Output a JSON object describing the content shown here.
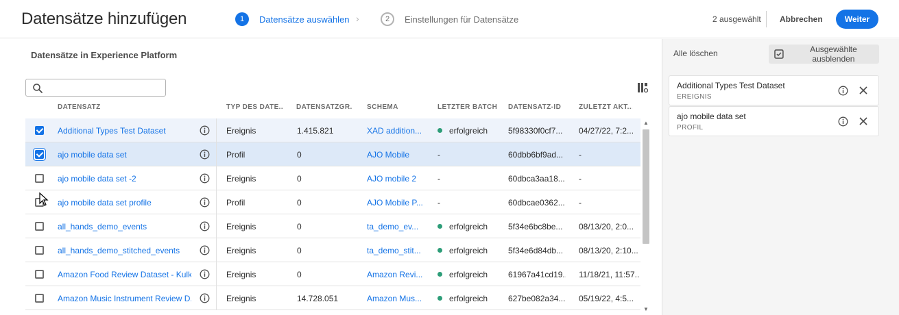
{
  "header": {
    "title": "Datensätze hinzufügen",
    "steps": [
      {
        "num": "1",
        "label": "Datensätze auswählen",
        "active": true
      },
      {
        "num": "2",
        "label": "Einstellungen für Datensätze",
        "active": false
      }
    ],
    "selected_count": "2 ausgewählt",
    "cancel_label": "Abbrechen",
    "next_label": "Weiter"
  },
  "main": {
    "section_title": "Datensätze in Experience Platform",
    "search": {
      "value": "",
      "placeholder": ""
    },
    "columns": [
      "DATENSATZ",
      "TYP DES DATE...",
      "DATENSATZGR...",
      "SCHEMA",
      "LETZTER BATCH",
      "DATENSATZ-ID",
      "ZULETZT AKT..."
    ],
    "rows": [
      {
        "checked": true,
        "name": "Additional Types Test Dataset",
        "type": "Ereignis",
        "size": "1.415.821",
        "schema": "XAD addition...",
        "batch": "erfolgreich",
        "batch_ok": true,
        "id": "5f98330f0cf7...",
        "updated": "04/27/22, 7:2..."
      },
      {
        "checked": true,
        "name": "ajo mobile data set",
        "type": "Profil",
        "size": "0",
        "schema": "AJO Mobile",
        "batch": "-",
        "batch_ok": false,
        "id": "60dbb6bf9ad...",
        "updated": "-"
      },
      {
        "checked": false,
        "name": "ajo mobile data set -2",
        "type": "Ereignis",
        "size": "0",
        "schema": "AJO mobile 2",
        "batch": "-",
        "batch_ok": false,
        "id": "60dbca3aa18...",
        "updated": "-"
      },
      {
        "checked": false,
        "name": "ajo mobile data set profile",
        "type": "Profil",
        "size": "0",
        "schema": "AJO Mobile P...",
        "batch": "-",
        "batch_ok": false,
        "id": "60dbcae0362...",
        "updated": "-"
      },
      {
        "checked": false,
        "name": "all_hands_demo_events",
        "type": "Ereignis",
        "size": "0",
        "schema": "ta_demo_ev...",
        "batch": "erfolgreich",
        "batch_ok": true,
        "id": "5f34e6bc8be...",
        "updated": "08/13/20, 2:0..."
      },
      {
        "checked": false,
        "name": "all_hands_demo_stitched_events",
        "type": "Ereignis",
        "size": "0",
        "schema": "ta_demo_stit...",
        "batch": "erfolgreich",
        "batch_ok": true,
        "id": "5f34e6d84db...",
        "updated": "08/13/20, 2:10..."
      },
      {
        "checked": false,
        "name": "Amazon Food Review Dataset - Kulk...",
        "type": "Ereignis",
        "size": "0",
        "schema": "Amazon Revi...",
        "batch": "erfolgreich",
        "batch_ok": true,
        "id": "61967a41cd19...",
        "updated": "11/18/21, 11:57..."
      },
      {
        "checked": false,
        "name": "Amazon Music Instrument Review D...",
        "type": "Ereignis",
        "size": "14.728.051",
        "schema": "Amazon Mus...",
        "batch": "erfolgreich",
        "batch_ok": true,
        "id": "627be082a34...",
        "updated": "05/19/22, 4:5..."
      }
    ]
  },
  "panel": {
    "clear_all_label": "Alle löschen",
    "hide_selected_label": "Ausgewählte ausblenden",
    "selected": [
      {
        "name": "Additional Types Test Dataset",
        "type": "EREIGNIS"
      },
      {
        "name": "ajo mobile data set",
        "type": "PROFIL"
      }
    ]
  },
  "colors": {
    "accent": "#1473e6",
    "success": "#2d9d78",
    "selected_row": "#dde9f8"
  }
}
